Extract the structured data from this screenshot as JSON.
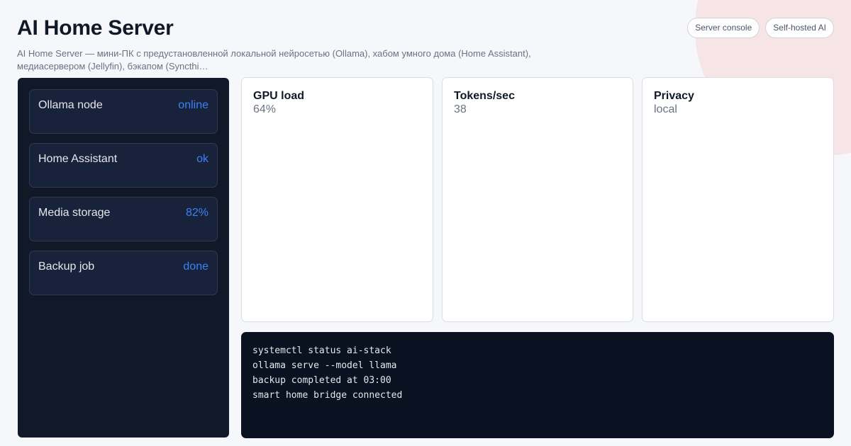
{
  "header": {
    "title": "AI Home Server",
    "subtitle": "AI Home Server — мини-ПК с предустановленной локальной нейросетью (Ollama), хабом умного дома (Home Assistant), медиасервером (Jellyfin), бэкапом (Syncthi…"
  },
  "actions": [
    {
      "label": "Server console"
    },
    {
      "label": "Self-hosted AI"
    }
  ],
  "services": [
    {
      "label": "Ollama node",
      "status": "online"
    },
    {
      "label": "Home Assistant",
      "status": "ok"
    },
    {
      "label": "Media storage",
      "status": "82%"
    },
    {
      "label": "Backup job",
      "status": "done"
    }
  ],
  "metrics": [
    {
      "label": "GPU load",
      "value": "64%"
    },
    {
      "label": "Tokens/sec",
      "value": "38"
    },
    {
      "label": "Privacy",
      "value": "local"
    }
  ],
  "terminal": {
    "lines": [
      "systemctl status ai-stack",
      "ollama serve --model llama",
      "backup completed at 03:00",
      "smart home bridge connected"
    ]
  },
  "colors": {
    "accent": "#3b82f6",
    "sidebar_bg": "#111827",
    "terminal_bg": "#0a1120",
    "decor_circle": "#f6e1e3"
  }
}
